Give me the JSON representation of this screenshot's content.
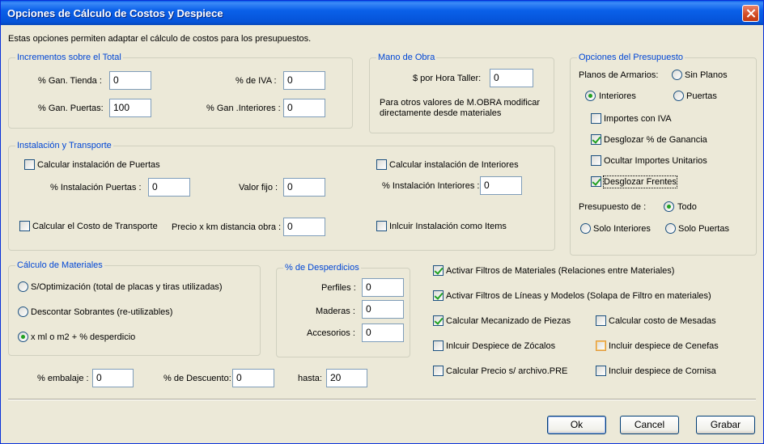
{
  "window": {
    "title": "Opciones de Cálculo de Costos y Despiece"
  },
  "intro": "Estas opciones permiten adaptar el cálculo de costos para los presupuestos.",
  "incrementos": {
    "title": "Incrementos sobre el Total",
    "gan_tienda": {
      "label": "% Gan. Tienda :",
      "value": "0"
    },
    "gan_puertas": {
      "label": "% Gan. Puertas:",
      "value": "100"
    },
    "iva": {
      "label": "% de IVA :",
      "value": "0"
    },
    "gan_interiores": {
      "label": "% Gan .Interiores :",
      "value": "0"
    }
  },
  "mano_obra": {
    "title": "Mano de Obra",
    "hora_label": "$ por Hora Taller:",
    "hora_value": "0",
    "note_line1": "Para otros valores de M.OBRA modificar",
    "note_line2": "directamente desde materiales"
  },
  "opciones_presupuesto": {
    "title": "Opciones del Presupuesto",
    "planos_label": "Planos de Armarios:",
    "sin_planos": "Sin Planos",
    "interiores": "Interiores",
    "puertas": "Puertas",
    "importes_iva": "Importes con IVA",
    "desglozar_ganancia": "Desglozar % de Ganancia",
    "ocultar_unitarios": "Ocultar Importes Unitarios",
    "desglozar_frentes": "Desglozar Frentes",
    "presupuesto_de": "Presupuesto de :",
    "todo": "Todo",
    "solo_interiores": "Solo Interiores",
    "solo_puertas": "Solo Puertas"
  },
  "instalacion": {
    "title": "Instalación y Transporte",
    "calc_puertas": "Calcular instalación de Puertas",
    "calc_interiores": "Calcular instalación de Interiores",
    "inst_puertas_label": "% Instalación Puertas :",
    "inst_puertas_value": "0",
    "valor_fijo_label": "Valor fijo :",
    "valor_fijo_value": "0",
    "inst_interiores_label": "% Instalación Interiores :",
    "inst_interiores_value": "0",
    "calc_transporte": "Calcular el Costo de Transporte",
    "precio_km_label": "Precio x km distancia obra :",
    "precio_km_value": "0",
    "incluir_items": "Inlcuir Instalación como Items"
  },
  "materiales": {
    "title": "Cálculo de Materiales",
    "optimizacion": "S/Optimización (total de placas y tiras utilizadas)",
    "sobrantes": "Descontar Sobrantes (re-utilizables)",
    "desperdicio": "x ml o m2 + % desperdicio"
  },
  "desperdicios": {
    "title": "% de Desperdicios",
    "perfiles_label": "Perfiles :",
    "perfiles_value": "0",
    "maderas_label": "Maderas :",
    "maderas_value": "0",
    "accesorios_label": "Accesorios :",
    "accesorios_value": "0"
  },
  "filtros": {
    "filtros_materiales": "Activar Filtros de Materiales (Relaciones entre Materiales)",
    "filtros_lineas": "Activar Filtros de Líneas y Modelos (Solapa de Filtro en materiales)",
    "mecanizado": "Calcular Mecanizado de Piezas",
    "mesadas": "Calcular costo de Mesadas",
    "zocalos": "Inlcuir Despiece de Zócalos",
    "cenefas": "Incluir despiece de Cenefas",
    "precio_pre": "Calcular Precio s/ archivo.PRE",
    "cornisa": "Incluir despiece de Cornisa"
  },
  "bottom": {
    "embalaje_label": "% embalaje :",
    "embalaje_value": "0",
    "descuento_label": "% de Descuento:",
    "descuento_value": "0",
    "hasta_label": "hasta:",
    "hasta_value": "20"
  },
  "buttons": {
    "ok": "Ok",
    "cancel": "Cancel",
    "save": "Grabar"
  }
}
